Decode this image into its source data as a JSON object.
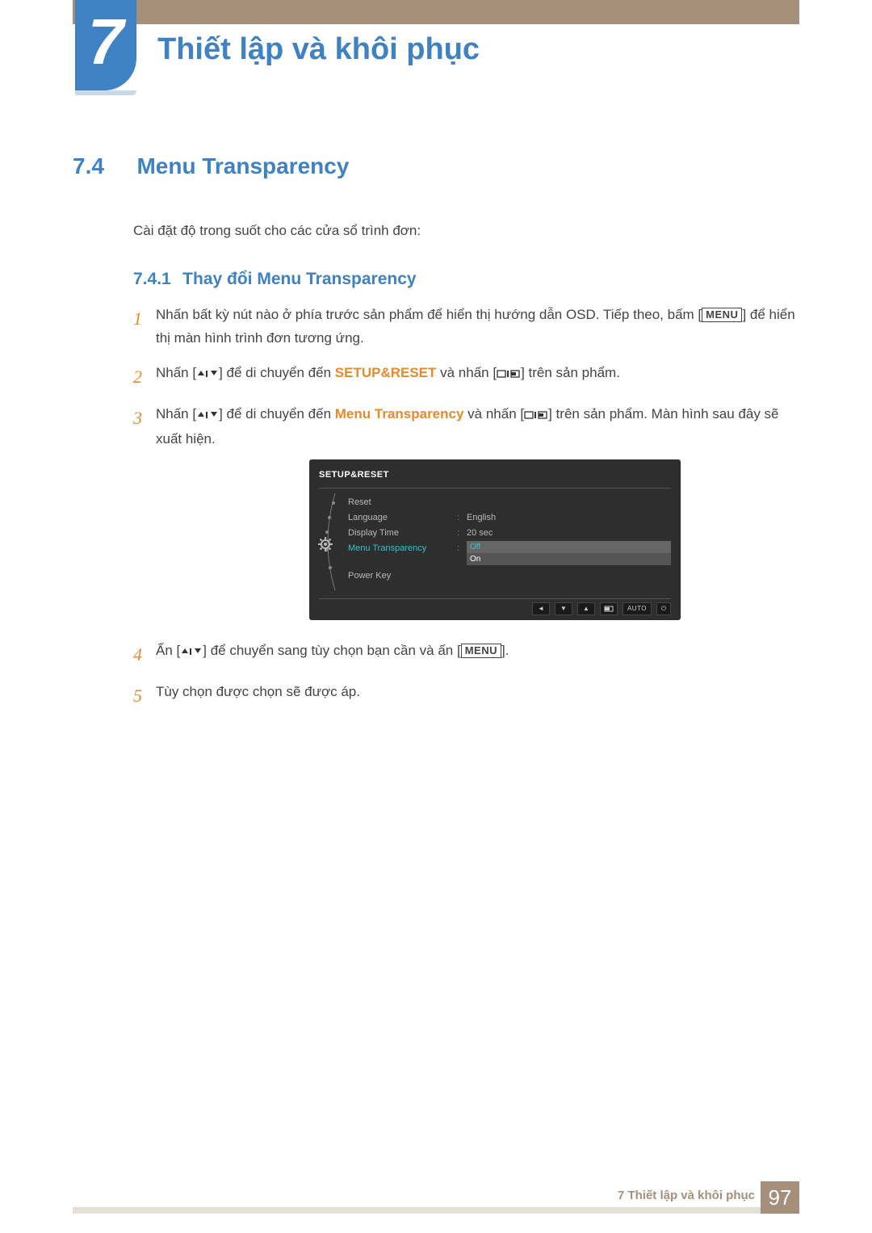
{
  "chapter": {
    "number": "7",
    "title": "Thiết lập và khôi phục"
  },
  "section": {
    "number": "7.4",
    "title": "Menu Transparency",
    "intro": "Cài đặt độ trong suốt cho các cửa sổ trình đơn:"
  },
  "subsection": {
    "number": "7.4.1",
    "title": "Thay đổi Menu Transparency"
  },
  "steps": {
    "s1_a": "Nhấn bất kỳ nút nào ở phía trước sản phẩm để hiển thị hướng dẫn OSD. Tiếp theo, bấm [",
    "s1_menu": "MENU",
    "s1_b": "] để hiển thị màn hình trình đơn tương ứng.",
    "s2_a": "Nhấn [",
    "s2_b": "] để di chuyển đến ",
    "s2_kw": "SETUP&RESET",
    "s2_c": " và nhấn [",
    "s2_d": "] trên sản phẩm.",
    "s3_a": "Nhấn [",
    "s3_b": "] để di chuyển đến ",
    "s3_kw": "Menu Transparency",
    "s3_c": " và nhấn [",
    "s3_d": "] trên sản phẩm. Màn hình sau đây sẽ xuất hiện.",
    "s4_a": "Ấn [",
    "s4_b": "] để chuyển sang tùy chọn bạn cần và ấn [",
    "s4_menu": "MENU",
    "s4_c": "].",
    "s5": "Tùy chọn được chọn sẽ được áp."
  },
  "osd": {
    "title": "SETUP&RESET",
    "rows": {
      "reset": "Reset",
      "language": "Language",
      "language_val": "English",
      "display_time": "Display Time",
      "display_time_val": "20 sec",
      "menu_transparency": "Menu Transparency",
      "opt_off": "Off",
      "opt_on": "On",
      "power_key": "Power Key"
    },
    "footer_auto": "AUTO"
  },
  "footer": {
    "text": "7 Thiết lập và khôi phục",
    "page": "97"
  }
}
